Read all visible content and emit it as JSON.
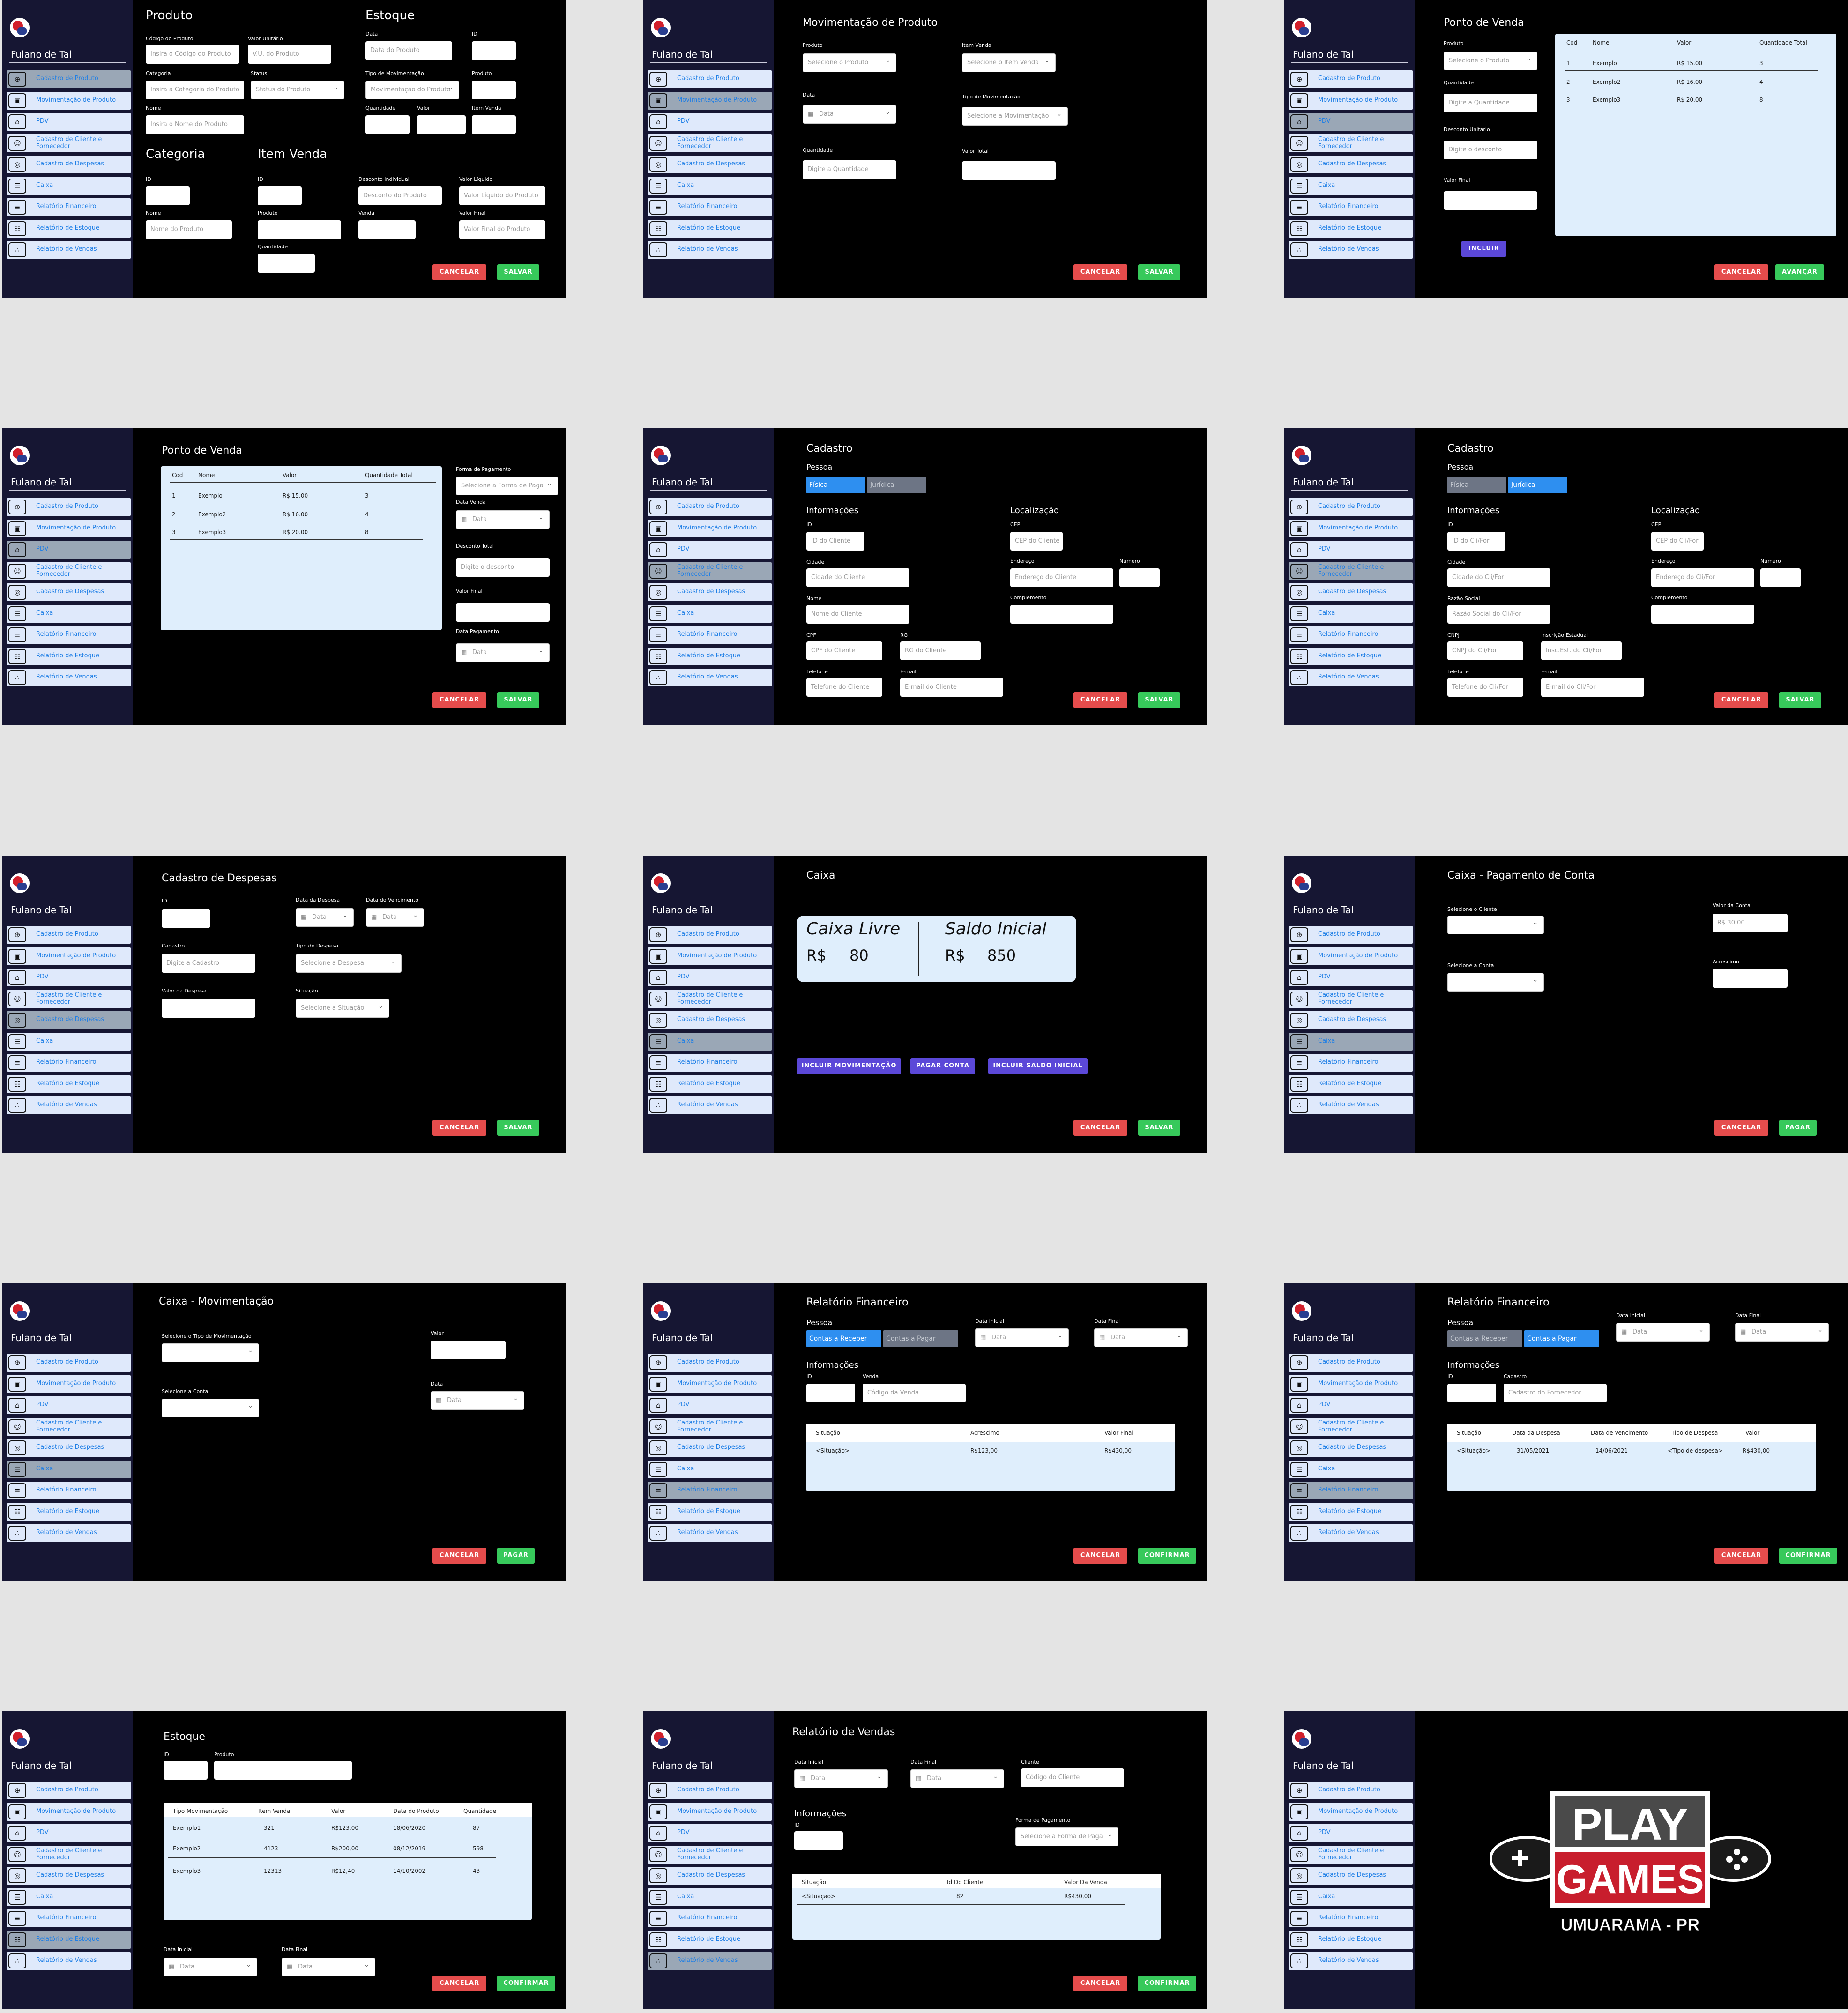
{
  "user_name": "Fulano de Tal",
  "nav": [
    "Cadastro de Produto",
    "Movimentação de Produto",
    "PDV",
    "Cadastro de Cliente e Fornecedor",
    "Cadastro de Despesas",
    "Caixa",
    "Relatório Financeiro",
    "Relatório de Estoque",
    "Relatório de Vendas"
  ],
  "nav_icons": [
    "gamepad-icon",
    "cart-icon",
    "home-icon",
    "handshake-icon",
    "money-icon",
    "cashier-icon",
    "report-icon",
    "stock-icon",
    "sales-icon"
  ],
  "buttons": {
    "cancel": "CANCELAR",
    "save": "SALVAR",
    "advance": "AVANÇAR",
    "include": "INCLUIR",
    "pay": "PAGAR",
    "confirm": "CONFIRMAR",
    "incl_mov": "INCLUIR MOVIMENTAÇÃO",
    "pay_account": "PAGAR CONTA",
    "incl_saldo": "INCLUIR SALDO INICIAL"
  },
  "s1": {
    "produto": "Produto",
    "estoque": "Estoque",
    "categoria": "Categoria",
    "item_venda": "Item Venda",
    "l_codigo": "Código do Produto",
    "p_codigo": "Insira o Código do Produto",
    "l_valor_unit": "Valor Unitário",
    "p_valor_unit": "V.U. do Produto",
    "l_categoria": "Categoria",
    "p_categoria": "Insira a Categoria do Produto",
    "l_status": "Status",
    "p_status": "Status do Produto",
    "l_nome": "Nome",
    "p_nome": "Insira o Nome do Produto",
    "l_data": "Data",
    "p_data": "Data do Produto",
    "l_id": "ID",
    "l_tipo_mov": "Tipo de Movimentação",
    "p_tipo_mov": "Movimentação do Produto",
    "l_produto": "Produto",
    "l_quantidade": "Quantidade",
    "l_valor": "Valor",
    "l_item_venda": "Item Venda",
    "p_cat_nome": "Nome do Produto",
    "l_desc_ind": "Desconto Individual",
    "p_desc_ind": "Desconto do Produto",
    "l_valor_liq": "Valor Líquido",
    "p_valor_liq": "Valor Líquido do Produto",
    "l_venda": "Venda",
    "l_valor_final": "Valor Final",
    "p_valor_final": "Valor Final do Produto"
  },
  "s2": {
    "title": "Movimentação de Produto",
    "l_produto": "Produto",
    "p_produto": "Selecione o Produto",
    "l_item_venda": "Item Venda",
    "p_item_venda": "Selecione o Item Venda",
    "l_data": "Data",
    "p_data": "Data",
    "l_tipo_mov": "Tipo de Movimentação",
    "p_tipo_mov": "Selecione a Movimentação",
    "l_quantidade": "Quantidade",
    "p_quantidade": "Digite a Quantidade",
    "l_valor_total": "Valor Total"
  },
  "s3": {
    "title": "Ponto de Venda",
    "l_produto": "Produto",
    "p_produto": "Selecione o Produto",
    "l_quantidade": "Quantidade",
    "p_quantidade": "Digite a Quantidade",
    "l_desconto": "Desconto Unitario",
    "p_desconto": "Digite o desconto",
    "l_valor_final": "Valor Final"
  },
  "pdv_table": {
    "headers": [
      "Cod",
      "Nome",
      "Valor",
      "Quantidade Total"
    ],
    "rows": [
      [
        "1",
        "Exemplo",
        "R$ 15.00",
        "3"
      ],
      [
        "2",
        "Exemplo2",
        "R$ 16.00",
        "4"
      ],
      [
        "3",
        "Exemplo3",
        "R$ 20.00",
        "8"
      ]
    ]
  },
  "s4": {
    "title": "Ponto de Venda",
    "l_forma": "Forma de Pagamento",
    "p_forma": "Selecione a Forma de Paga",
    "l_data_venda": "Data Venda",
    "p_data": "Data",
    "l_desc_total": "Desconto Total",
    "p_desc_total": "Digite o desconto",
    "l_valor_final": "Valor Final",
    "l_data_pag": "Data Pagamento"
  },
  "s5": {
    "title": "Cadastro",
    "pessoa": "Pessoa",
    "fisica": "Física",
    "juridica": "Jurídica",
    "informacoes": "Informações",
    "localizacao": "Localização",
    "l_id": "ID",
    "p_id": "ID do Cliente",
    "l_cidade": "Cidade",
    "p_cidade": "Cidade do Cliente",
    "l_nome": "Nome",
    "p_nome": "Nome do Cliente",
    "l_cpf": "CPF",
    "p_cpf": "CPF do Cliente",
    "l_rg": "RG",
    "p_rg": "RG do Cliente",
    "l_telefone": "Telefone",
    "p_telefone": "Telefone do Cliente",
    "l_email": "E-mail",
    "p_email": "E-mail do Cliente",
    "l_cep": "CEP",
    "p_cep": "CEP do Cliente",
    "l_endereco": "Endereço",
    "p_endereco": "Endereço do Cliente",
    "l_numero": "Número",
    "l_complemento": "Complemento"
  },
  "s6": {
    "title": "Cadastro",
    "pessoa": "Pessoa",
    "fisica": "Física",
    "juridica": "Jurídica",
    "informacoes": "Informações",
    "localizacao": "Localização",
    "l_id": "ID",
    "p_id": "ID do Cli/For",
    "l_cidade": "Cidade",
    "p_cidade": "Cidade do Cli/For",
    "l_razao": "Razão Social",
    "p_razao": "Razão Social do Cli/For",
    "l_cnpj": "CNPJ",
    "p_cnpj": "CNPJ do Cli/For",
    "l_ie": "Inscrição Estadual",
    "p_ie": "Insc.Est. do Cli/For",
    "l_telefone": "Telefone",
    "p_telefone": "Telefone do Cli/For",
    "l_email": "E-mail",
    "p_email": "E-mail do Cli/For",
    "l_cep": "CEP",
    "p_cep": "CEP do Cli/For",
    "l_endereco": "Endereço",
    "p_endereco": "Endereço do Cli/For",
    "l_numero": "Número",
    "l_complemento": "Complemento"
  },
  "s7": {
    "title": "Cadastro de Despesas",
    "l_id": "ID",
    "l_data_despesa": "Data da Despesa",
    "l_data_venc": "Data do Vencimento",
    "p_data": "Data",
    "l_cadastro": "Cadastro",
    "p_cadastro": "Digite a Cadastro",
    "l_tipo": "Tipo de Despesa",
    "p_tipo": "Selecione a Despesa",
    "l_valor": "Valor da Despesa",
    "l_situacao": "Situação",
    "p_situacao": "Selecione a Situação"
  },
  "s8": {
    "title": "Caixa",
    "caixa_livre": "Caixa Livre",
    "saldo_inicial": "Saldo Inicial",
    "cl_currency": "R$",
    "cl_value": "80",
    "si_currency": "R$",
    "si_value": "850"
  },
  "s9": {
    "title": "Caixa - Pagamento de Conta",
    "l_cliente": "Selecione o Cliente",
    "l_conta": "Selecione a Conta",
    "l_valor_conta": "Valor da Conta",
    "p_valor_conta": "R$ 30,00",
    "l_acrescimo": "Acrescimo"
  },
  "s10": {
    "title": "Caixa - Movimentação",
    "l_tipo": "Selecione o Tipo de Movimentação",
    "l_conta": "Selecione a Conta",
    "l_valor": "Valor",
    "l_data": "Data",
    "p_data": "Data"
  },
  "s11": {
    "title": "Relatório Financeiro",
    "pessoa": "Pessoa",
    "receber": "Contas a Receber",
    "pagar": "Contas a Pagar",
    "l_data_ini": "Data Inicial",
    "l_data_fim": "Data Final",
    "p_data": "Data",
    "informacoes": "Informações",
    "l_id": "ID",
    "l_venda": "Venda",
    "p_venda": "Código da Venda",
    "headers": [
      "Situação",
      "Acrescimo",
      "Valor Final"
    ],
    "row": [
      "<Situação>",
      "R$123,00",
      "R$430,00"
    ]
  },
  "s12": {
    "title": "Relatório Financeiro",
    "pessoa": "Pessoa",
    "receber": "Contas a Receber",
    "pagar": "Contas a Pagar",
    "l_data_ini": "Data Inicial",
    "l_data_fim": "Data Final",
    "p_data": "Data",
    "informacoes": "Informações",
    "l_id": "ID",
    "l_cadastro": "Cadastro",
    "p_cadastro": "Cadastro do Fornecedor",
    "headers": [
      "Situação",
      "Data da Despesa",
      "Data de Vencimento",
      "Tipo de Despesa",
      "Valor"
    ],
    "row": [
      "<Situação>",
      "31/05/2021",
      "14/06/2021",
      "<Tipo de despesa>",
      "R$430,00"
    ]
  },
  "s13": {
    "title": "Estoque",
    "l_id": "ID",
    "l_produto": "Produto",
    "headers": [
      "Tipo Movimentação",
      "Item Venda",
      "Valor",
      "Data do Produto",
      "Quantidade"
    ],
    "rows": [
      [
        "Exemplo1",
        "321",
        "R$123,00",
        "18/06/2020",
        "87"
      ],
      [
        "Exemplo2",
        "4123",
        "R$200,00",
        "08/12/2019",
        "598"
      ],
      [
        "Exemplo3",
        "12313",
        "R$12,40",
        "14/10/2002",
        "43"
      ]
    ],
    "l_data_ini": "Data Inicial",
    "l_data_fim": "Data Final",
    "p_data": "Data"
  },
  "s14": {
    "title": "Relatório de Vendas",
    "l_data_ini": "Data Inicial",
    "l_data_fim": "Data Final",
    "p_data": "Data",
    "l_cliente": "Cliente",
    "p_cliente": "Código do Cliente",
    "informacoes": "Informações",
    "l_id": "ID",
    "l_forma": "Forma de Pagamento",
    "p_forma": "Selecione a Forma de Paga",
    "headers": [
      "Situação",
      "Id Do Cliente",
      "Valor Da Venda"
    ],
    "row": [
      "<Situação>",
      "82",
      "R$430,00"
    ]
  },
  "s15": {
    "play": "PLAY",
    "games": "GAMES",
    "city": "UMUARAMA - PR"
  }
}
